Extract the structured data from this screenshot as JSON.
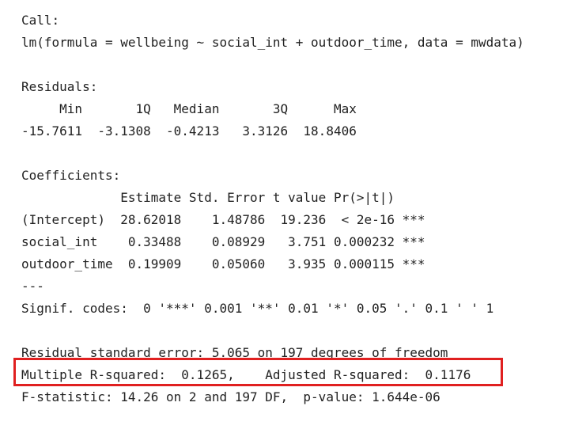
{
  "output": {
    "call_header": "Call:",
    "call_formula": "lm(formula = wellbeing ~ social_int + outdoor_time, data = mwdata)",
    "residuals_header": "Residuals:",
    "residuals_labels": "     Min       1Q   Median       3Q      Max ",
    "residuals_values": "-15.7611  -3.1308  -0.4213   3.3126  18.8406 ",
    "coefficients_header": "Coefficients:",
    "coef_columns": "             Estimate Std. Error t value Pr(>|t|)    ",
    "coef_rows": [
      "(Intercept)  28.62018    1.48786  19.236  < 2e-16 ***",
      "social_int    0.33488    0.08929   3.751 0.000232 ***",
      "outdoor_time  0.19909    0.05060   3.935 0.000115 ***"
    ],
    "separator": "---",
    "signif_codes": "Signif. codes:  0 '***' 0.001 '**' 0.01 '*' 0.05 '.' 0.1 ' ' 1",
    "residual_se": "Residual standard error: 5.065 on 197 degrees of freedom",
    "r_squared": "Multiple R-squared:  0.1265,    Adjusted R-squared:  0.1176 ",
    "f_statistic": "F-statistic: 14.26 on 2 and 197 DF,  p-value: 1.644e-06"
  },
  "highlight_color": "#e02020"
}
